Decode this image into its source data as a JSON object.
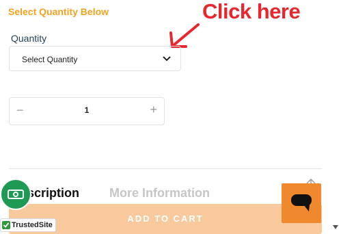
{
  "section": {
    "heading": "Select Quantity Below"
  },
  "annotation": {
    "text": "Click here"
  },
  "quantity": {
    "label": "Quantity",
    "select_value": "Select Quantity",
    "stepper_value": "1",
    "minus": "−",
    "plus": "+"
  },
  "tabs": [
    {
      "label": "scription"
    },
    {
      "label": "More Information"
    }
  ],
  "cart": {
    "label": "ADD TO CART"
  },
  "badge": {
    "label": "TrustedSite"
  },
  "colors": {
    "accent": "#f0a21f",
    "annotation": "#e8262e",
    "cart_button": "#f7c99c",
    "chat_button": "#f0892e",
    "money_button": "#1f9a55"
  }
}
